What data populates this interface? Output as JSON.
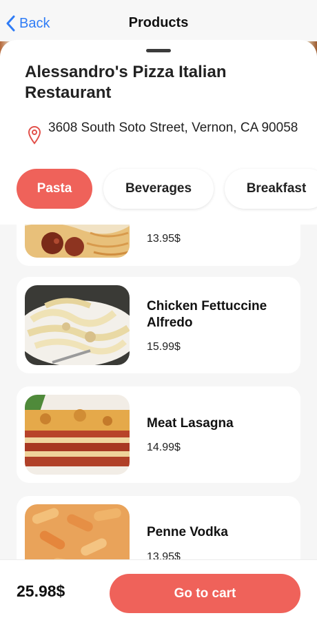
{
  "nav": {
    "back_label": "Back",
    "title": "Products"
  },
  "restaurant": {
    "name": "Alessandro's Pizza Italian Restaurant",
    "address": "3608 South Soto Street, Vernon, CA 90058"
  },
  "categories": [
    {
      "label": "Pasta",
      "active": true
    },
    {
      "label": "Beverages",
      "active": false
    },
    {
      "label": "Breakfast",
      "active": false
    }
  ],
  "products": [
    {
      "name": "",
      "price": "13.95$",
      "image": "spaghetti-meatballs"
    },
    {
      "name": "Chicken Fettuccine Alfredo",
      "price": "15.99$",
      "image": "fettuccine-alfredo"
    },
    {
      "name": "Meat Lasagna",
      "price": "14.99$",
      "image": "lasagna"
    },
    {
      "name": "Penne Vodka",
      "price": "13.95$",
      "image": "penne-vodka"
    }
  ],
  "cart": {
    "total": "25.98$",
    "button_label": "Go to cart"
  },
  "colors": {
    "accent": "#ef625a",
    "link": "#2f7cf6"
  },
  "icons": {
    "back": "chevron-left-icon",
    "location": "map-pin-icon"
  }
}
